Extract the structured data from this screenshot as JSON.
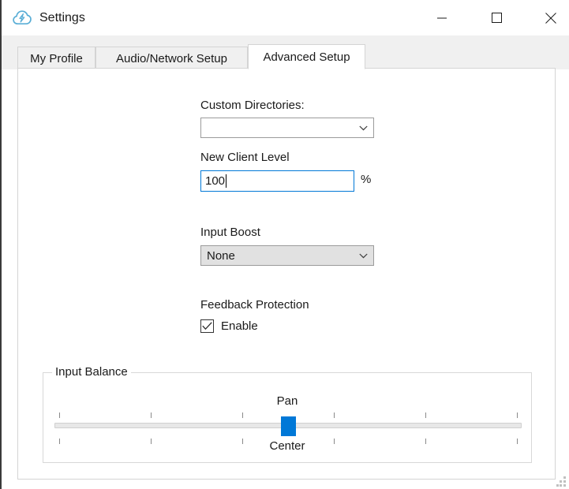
{
  "window": {
    "title": "Settings",
    "app_icon": "cloud-lightning-icon",
    "controls": {
      "minimize": "minimize-icon",
      "maximize": "maximize-icon",
      "close": "close-icon"
    }
  },
  "tabs": [
    {
      "label": "My Profile",
      "active": false
    },
    {
      "label": "Audio/Network Setup",
      "active": false
    },
    {
      "label": "Advanced Setup",
      "active": true
    }
  ],
  "form": {
    "custom_directories": {
      "label": "Custom Directories:",
      "value": "",
      "placeholder": ""
    },
    "new_client_level": {
      "label": "New Client Level",
      "value": "100",
      "unit": "%"
    },
    "input_boost": {
      "label": "Input Boost",
      "value": "None"
    },
    "feedback_protection": {
      "label": "Feedback Protection",
      "checkbox_label": "Enable",
      "checked": true
    }
  },
  "input_balance": {
    "legend": "Input Balance",
    "slider": {
      "top_label": "Pan",
      "bottom_label": "Center",
      "tick_count": 6,
      "thumb_position_percent": 50
    }
  },
  "colors": {
    "accent": "#0078d7",
    "window_bg": "#f0f0f0",
    "panel_bg": "#ffffff",
    "control_gray": "#e1e1e1",
    "border": "#d4d4d4"
  }
}
